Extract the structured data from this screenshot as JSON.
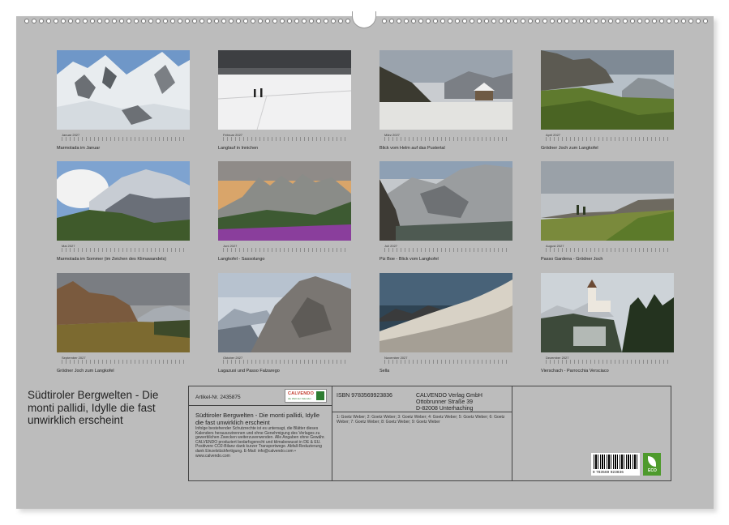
{
  "tiles": [
    {
      "month": "Januar 2027",
      "caption": "Marmolada im Januar"
    },
    {
      "month": "Februar 2027",
      "caption": "Langlauf in Innichen"
    },
    {
      "month": "März 2027",
      "caption": "Blick vom Helm auf das Pustertal"
    },
    {
      "month": "April 2027",
      "caption": "Grödner Joch zum Langkofel"
    },
    {
      "month": "Mai 2027",
      "caption": "Marmolada im Sommer (im Zeichen des Klimawandels)"
    },
    {
      "month": "Juni 2027",
      "caption": "Langkofel - Sassolungo"
    },
    {
      "month": "Juli 2027",
      "caption": "Piz Boe - Blick vom Langkofel"
    },
    {
      "month": "August 2027",
      "caption": "Passo Gardena - Grödner Joch"
    },
    {
      "month": "September 2027",
      "caption": "Grödner Joch zum Langkofel"
    },
    {
      "month": "Oktober 2027",
      "caption": "Lagazuoi und Passo Falzarego"
    },
    {
      "month": "November 2027",
      "caption": "Sella"
    },
    {
      "month": "Dezember 2027",
      "caption": "Vierschach - Parrocchia Versciaco"
    }
  ],
  "cover_title": "Südtiroler Bergwelten - Die monti pallidi, Idylle die fast unwirklich erscheint",
  "info": {
    "artikel": "Artikel-Nr. 2435875",
    "logo_name": "CALVENDO",
    "logo_sub": "die Welt der Kalender",
    "subtitle": "Südtiroler Bergwelten - Die monti pallidi, Idylle die fast unwirklich erscheint",
    "legal": "Infolge bestehender Schutzrechte ist es untersagt, die Blätter dieses Kalenders herauszutrennen und ohne Genehmigung des Verlages zu gewerblichen Zwecken weiterzuverwenden. Alle Angaben ohne Gewähr. CALVENDO produziert bedarfsgerecht und klimabewusst in DE & EU. Positivere CO2-Bilanz dank kurzer Transportwege. Abfall-Reduzierung dank Einzelstückfertigung. E-Mail: info@calvendo.com • www.calvendo.com",
    "isbn": "ISBN 9783569923836",
    "publisher_lines": [
      "CALVENDO Verlag GmbH",
      "Ottobrunner Straße 39",
      "D-82008 Unterhaching"
    ],
    "credits": "1: Goetz Weber; 2: Goetz Weber; 3: Goetz Weber; 4: Goetz Weber; 5: Goetz Weber; 6: Goetz Weber; 7: Goetz Weber; 8: Goetz Weber; 9: Goetz Weber",
    "barcode_digits": "9 783569 923836",
    "eco_label": "ECO"
  }
}
